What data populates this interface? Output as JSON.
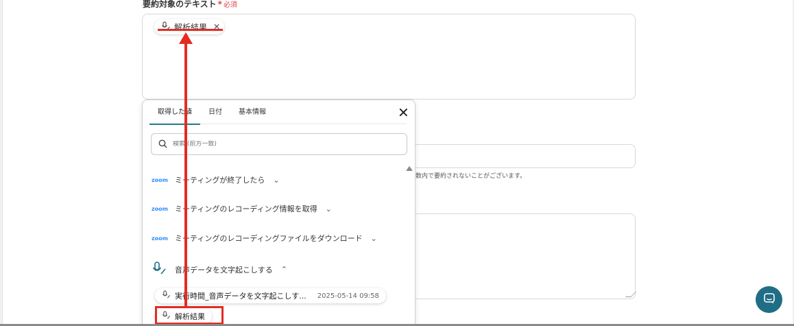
{
  "form": {
    "summary_field": {
      "label": "要約対象のテキスト",
      "required_mark": "*",
      "required_text": "必須",
      "token_label": "解析結果"
    },
    "help_text": "数内で要約されないことがございます。"
  },
  "popup": {
    "tabs": [
      "取得した値",
      "日付",
      "基本情報"
    ],
    "active_tab": "取得した値",
    "search_placeholder": "検索 (前方一致)",
    "steps": [
      {
        "logo": "zoom",
        "label": "ミーティングが終了したら",
        "state": "collapsed"
      },
      {
        "logo": "zoom",
        "label": "ミーティングのレコーディング情報を取得",
        "state": "collapsed"
      },
      {
        "logo": "zoom",
        "label": "ミーティングのレコーディングファイルをダウンロード",
        "state": "collapsed"
      },
      {
        "logo": "microphone-icon",
        "label": "音声データを文字起こしする",
        "state": "expanded"
      }
    ],
    "outputs": [
      {
        "label": "実行時間_音声データを文字起こしす...",
        "value": "2025-05-14 09:58"
      },
      {
        "label": "解析結果",
        "value": ""
      }
    ]
  },
  "colors": {
    "accent": "#1f7a8c",
    "required": "#e0424b",
    "annotation": "#e32b22",
    "zoom": "#2d8cff",
    "chat_button": "#1f6e86"
  }
}
